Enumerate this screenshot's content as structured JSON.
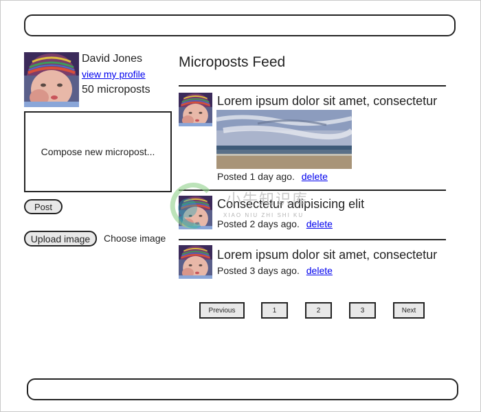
{
  "header": {
    "bar_label": ""
  },
  "footer": {
    "bar_label": ""
  },
  "sidebar": {
    "user_name": "David Jones",
    "profile_link": "view my profile",
    "micropost_count": "50 microposts",
    "avatar_icon": "user-avatar-photo",
    "compose_placeholder": "Compose new micropost...",
    "post_button": "Post",
    "upload_button": "Upload image",
    "choose_image_label": "Choose image"
  },
  "feed": {
    "title": "Microposts Feed",
    "posts": [
      {
        "text": "Lorem ipsum dolor sit amet, consectetur",
        "meta": "Posted 1 day ago.",
        "delete": "delete",
        "has_image": true,
        "image_icon": "beach-photo"
      },
      {
        "text": "Consectetur adipisicing elit",
        "meta": "Posted 2 days ago.",
        "delete": "delete",
        "has_image": false
      },
      {
        "text": "Lorem ipsum dolor sit amet, consectetur",
        "meta": "Posted 3 days ago.",
        "delete": "delete",
        "has_image": false
      }
    ]
  },
  "pagination": {
    "previous": "Previous",
    "pages": [
      "1",
      "2",
      "3"
    ],
    "next": "Next"
  },
  "watermark": {
    "cn": "小牛知识库",
    "en": "XIAO NIU ZHI SHI KU"
  }
}
